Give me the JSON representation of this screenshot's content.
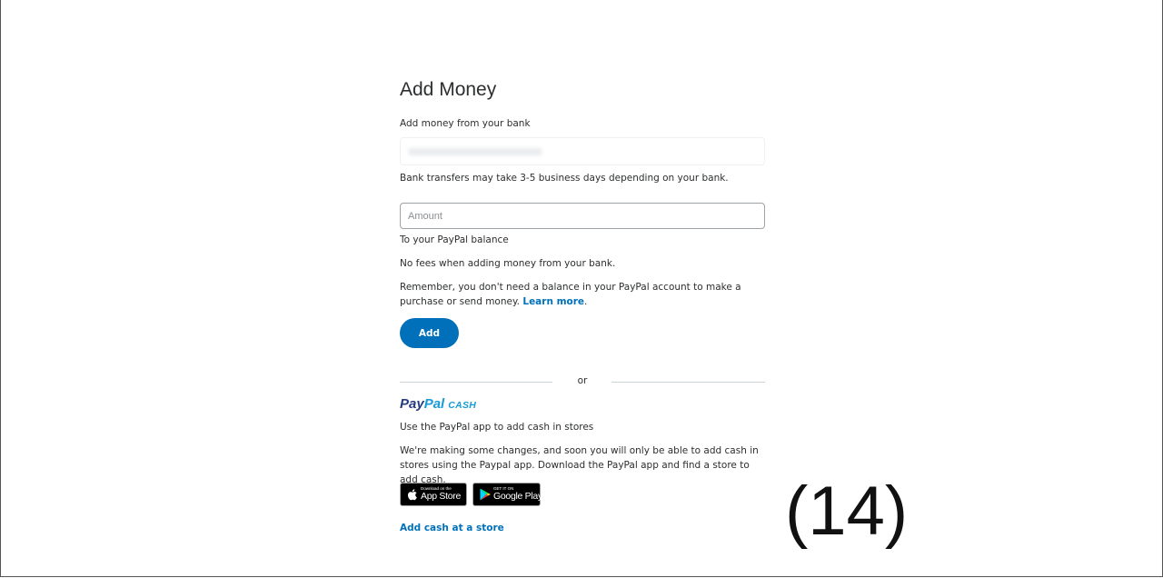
{
  "page": {
    "title": "Add Money",
    "bank_section_label": "Add money from your bank",
    "bank_note": "Bank transfers may take 3-5 business days depending on your bank.",
    "amount_placeholder": "Amount",
    "destination_label": "To your PayPal balance",
    "fees_note": "No fees when adding money from your bank.",
    "reminder_text": "Remember, you don't need a balance in your PayPal account to make a purchase or send money.",
    "learn_more_label": "Learn more",
    "add_button_label": "Add",
    "or_label": "or"
  },
  "paypal_cash": {
    "logo_pay": "Pay",
    "logo_pal": "Pal",
    "logo_cash": "CASH",
    "heading": "Use the PayPal app to add cash in stores",
    "description": "We're making some changes, and soon you will only be able to add cash in stores using the Paypal app. Download the PayPal app and find a store to add cash.",
    "app_store": {
      "small": "Download on the",
      "big": "App Store",
      "icon": "apple-icon"
    },
    "google_play": {
      "small": "GET IT ON",
      "big": "Google Play",
      "icon": "google-play-icon"
    },
    "add_cash_link": "Add cash at a store"
  },
  "annotation": {
    "page_number": "(14)"
  },
  "colors": {
    "brand_blue": "#0070ba",
    "paypal_dark": "#253b80",
    "paypal_light": "#179bd7"
  }
}
